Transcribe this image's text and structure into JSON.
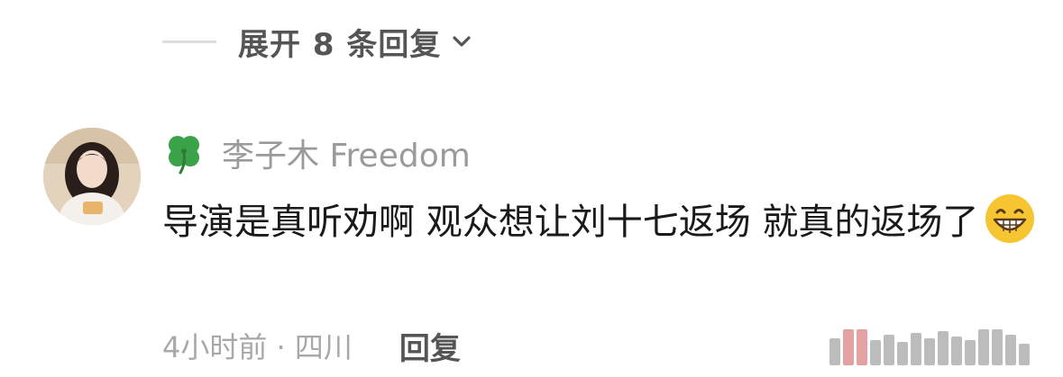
{
  "expand": {
    "label": "展开 8 条回复",
    "icon": "chevron-down-icon"
  },
  "comment": {
    "avatar": "user-avatar",
    "badge_icon": "four-leaf-clover-icon",
    "username": "李子木 Freedom",
    "text": "导演是真听劝啊 观众想让刘十七返场 就真的返场了",
    "emoji": "grinning-face-icon",
    "meta": "4小时前 · 四川",
    "reply_label": "回复"
  },
  "colors": {
    "muted": "#9a9a9a",
    "text": "#1a1a1a",
    "action": "#555555",
    "clover": "#3aa34a",
    "emoji": "#f7c531"
  }
}
